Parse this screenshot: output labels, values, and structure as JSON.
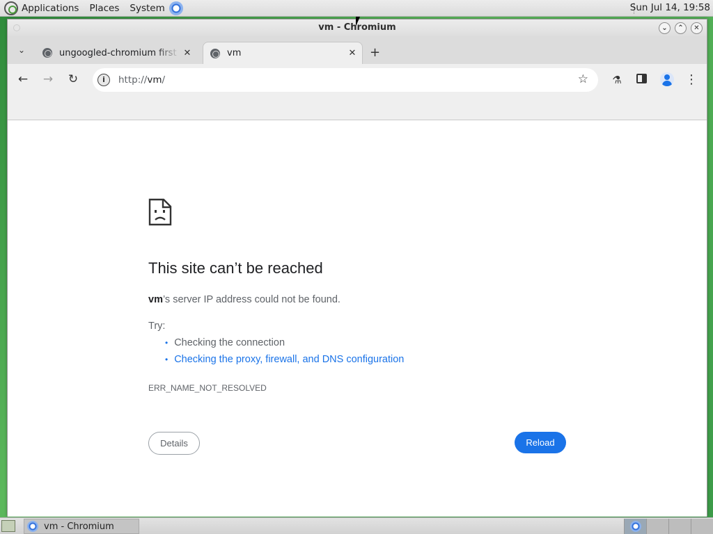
{
  "top_panel": {
    "menus": [
      "Applications",
      "Places",
      "System"
    ],
    "clock": "Sun Jul 14, 19:58"
  },
  "window": {
    "title": "vm - Chromium",
    "buttons": [
      "⌄",
      "⌃",
      "✕"
    ]
  },
  "tabs": [
    {
      "title": "ungoogled-chromium first run",
      "close": "✕",
      "active": false
    },
    {
      "title": "vm",
      "close": "✕",
      "active": true
    }
  ],
  "tab_strip": {
    "menu_glyph": "⌄",
    "new_tab": "+"
  },
  "toolbar": {
    "back": "←",
    "forward": "→",
    "reload": "↻",
    "url_scheme": "http://",
    "url_host": "vm",
    "url_path": "/",
    "info_glyph": "i",
    "star": "☆",
    "labs": "⚗",
    "menu": "⋮"
  },
  "error_page": {
    "title": "This site can’t be reached",
    "host": "vm",
    "desc_suffix": "’s server IP address could not be found.",
    "try_label": "Try:",
    "suggestions": [
      "Checking the connection",
      "Checking the proxy, firewall, and DNS configuration"
    ],
    "error_code": "ERR_NAME_NOT_RESOLVED",
    "details_label": "Details",
    "reload_label": "Reload"
  },
  "bottom_panel": {
    "task_label": "vm - Chromium"
  },
  "colors": {
    "accent": "#1a73e8",
    "desktop": "#4caf50"
  }
}
